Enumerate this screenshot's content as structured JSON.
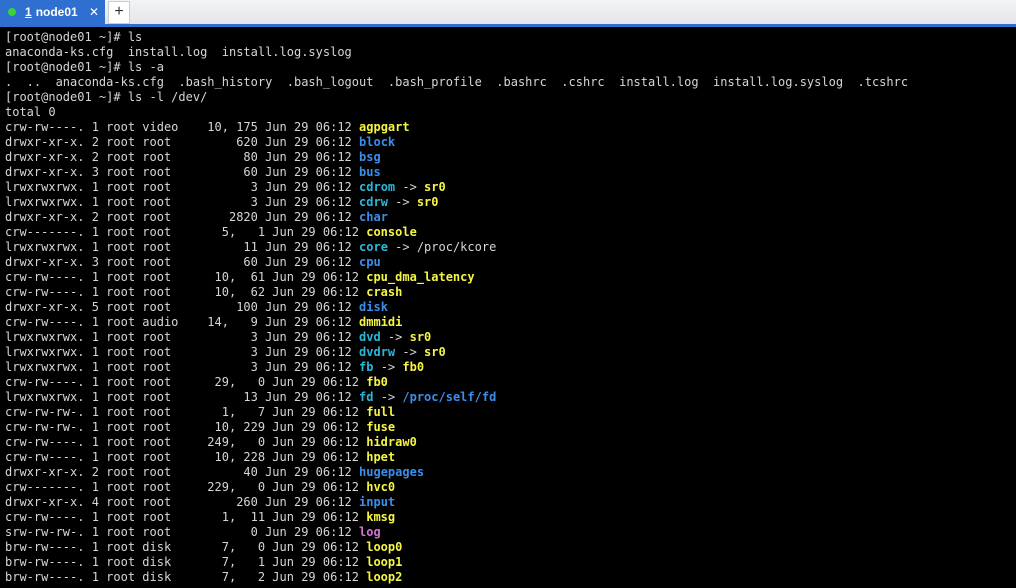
{
  "tab": {
    "number": "1",
    "title": "node01",
    "close": "✕",
    "add": "+"
  },
  "color_map": {
    "dir": "#3b8eea",
    "dev": "#f5f543",
    "link": "#29b8db",
    "sock": "#d670d6",
    "text": "#d6d6d6"
  },
  "terminal": {
    "lines": [
      {
        "text": "[root@node01 ~]# ls"
      },
      {
        "text": "anaconda-ks.cfg  install.log  install.log.syslog"
      },
      {
        "text": "[root@node01 ~]# ls -a"
      },
      {
        "text": ".  ..  anaconda-ks.cfg  .bash_history  .bash_logout  .bash_profile  .bashrc  .cshrc  install.log  install.log.syslog  .tcshrc"
      },
      {
        "text": "[root@node01 ~]# ls -l /dev/"
      },
      {
        "text": "total 0"
      },
      {
        "text": "crw-rw----. 1 root video    10, 175 Jun 29 06:12 ",
        "name": "agpgart",
        "type": "dev"
      },
      {
        "text": "drwxr-xr-x. 2 root root         620 Jun 29 06:12 ",
        "name": "block",
        "type": "dir"
      },
      {
        "text": "drwxr-xr-x. 2 root root          80 Jun 29 06:12 ",
        "name": "bsg",
        "type": "dir"
      },
      {
        "text": "drwxr-xr-x. 3 root root          60 Jun 29 06:12 ",
        "name": "bus",
        "type": "dir"
      },
      {
        "text": "lrwxrwxrwx. 1 root root           3 Jun 29 06:12 ",
        "name": "cdrom",
        "type": "link",
        "target": "sr0",
        "target_type": "dev"
      },
      {
        "text": "lrwxrwxrwx. 1 root root           3 Jun 29 06:12 ",
        "name": "cdrw",
        "type": "link",
        "target": "sr0",
        "target_type": "dev"
      },
      {
        "text": "drwxr-xr-x. 2 root root        2820 Jun 29 06:12 ",
        "name": "char",
        "type": "dir"
      },
      {
        "text": "crw-------. 1 root root       5,   1 Jun 29 06:12 ",
        "name": "console",
        "type": "dev"
      },
      {
        "text": "lrwxrwxrwx. 1 root root          11 Jun 29 06:12 ",
        "name": "core",
        "type": "link",
        "target": "/proc/kcore",
        "target_type": "text"
      },
      {
        "text": "drwxr-xr-x. 3 root root          60 Jun 29 06:12 ",
        "name": "cpu",
        "type": "dir"
      },
      {
        "text": "crw-rw----. 1 root root      10,  61 Jun 29 06:12 ",
        "name": "cpu_dma_latency",
        "type": "dev"
      },
      {
        "text": "crw-rw----. 1 root root      10,  62 Jun 29 06:12 ",
        "name": "crash",
        "type": "dev"
      },
      {
        "text": "drwxr-xr-x. 5 root root         100 Jun 29 06:12 ",
        "name": "disk",
        "type": "dir"
      },
      {
        "text": "crw-rw----. 1 root audio    14,   9 Jun 29 06:12 ",
        "name": "dmmidi",
        "type": "dev"
      },
      {
        "text": "lrwxrwxrwx. 1 root root           3 Jun 29 06:12 ",
        "name": "dvd",
        "type": "link",
        "target": "sr0",
        "target_type": "dev"
      },
      {
        "text": "lrwxrwxrwx. 1 root root           3 Jun 29 06:12 ",
        "name": "dvdrw",
        "type": "link",
        "target": "sr0",
        "target_type": "dev"
      },
      {
        "text": "lrwxrwxrwx. 1 root root           3 Jun 29 06:12 ",
        "name": "fb",
        "type": "link",
        "target": "fb0",
        "target_type": "dev"
      },
      {
        "text": "crw-rw----. 1 root root      29,   0 Jun 29 06:12 ",
        "name": "fb0",
        "type": "dev"
      },
      {
        "text": "lrwxrwxrwx. 1 root root          13 Jun 29 06:12 ",
        "name": "fd",
        "type": "link",
        "target": "/proc/self/fd",
        "target_type": "dir"
      },
      {
        "text": "crw-rw-rw-. 1 root root       1,   7 Jun 29 06:12 ",
        "name": "full",
        "type": "dev"
      },
      {
        "text": "crw-rw-rw-. 1 root root      10, 229 Jun 29 06:12 ",
        "name": "fuse",
        "type": "dev"
      },
      {
        "text": "crw-rw----. 1 root root     249,   0 Jun 29 06:12 ",
        "name": "hidraw0",
        "type": "dev"
      },
      {
        "text": "crw-rw----. 1 root root      10, 228 Jun 29 06:12 ",
        "name": "hpet",
        "type": "dev"
      },
      {
        "text": "drwxr-xr-x. 2 root root          40 Jun 29 06:12 ",
        "name": "hugepages",
        "type": "dir"
      },
      {
        "text": "crw-------. 1 root root     229,   0 Jun 29 06:12 ",
        "name": "hvc0",
        "type": "dev"
      },
      {
        "text": "drwxr-xr-x. 4 root root         260 Jun 29 06:12 ",
        "name": "input",
        "type": "dir"
      },
      {
        "text": "crw-rw----. 1 root root       1,  11 Jun 29 06:12 ",
        "name": "kmsg",
        "type": "dev"
      },
      {
        "text": "srw-rw-rw-. 1 root root           0 Jun 29 06:12 ",
        "name": "log",
        "type": "sock"
      },
      {
        "text": "brw-rw----. 1 root disk       7,   0 Jun 29 06:12 ",
        "name": "loop0",
        "type": "dev"
      },
      {
        "text": "brw-rw----. 1 root disk       7,   1 Jun 29 06:12 ",
        "name": "loop1",
        "type": "dev"
      },
      {
        "text": "brw-rw----. 1 root disk       7,   2 Jun 29 06:12 ",
        "name": "loop2",
        "type": "dev"
      }
    ]
  }
}
